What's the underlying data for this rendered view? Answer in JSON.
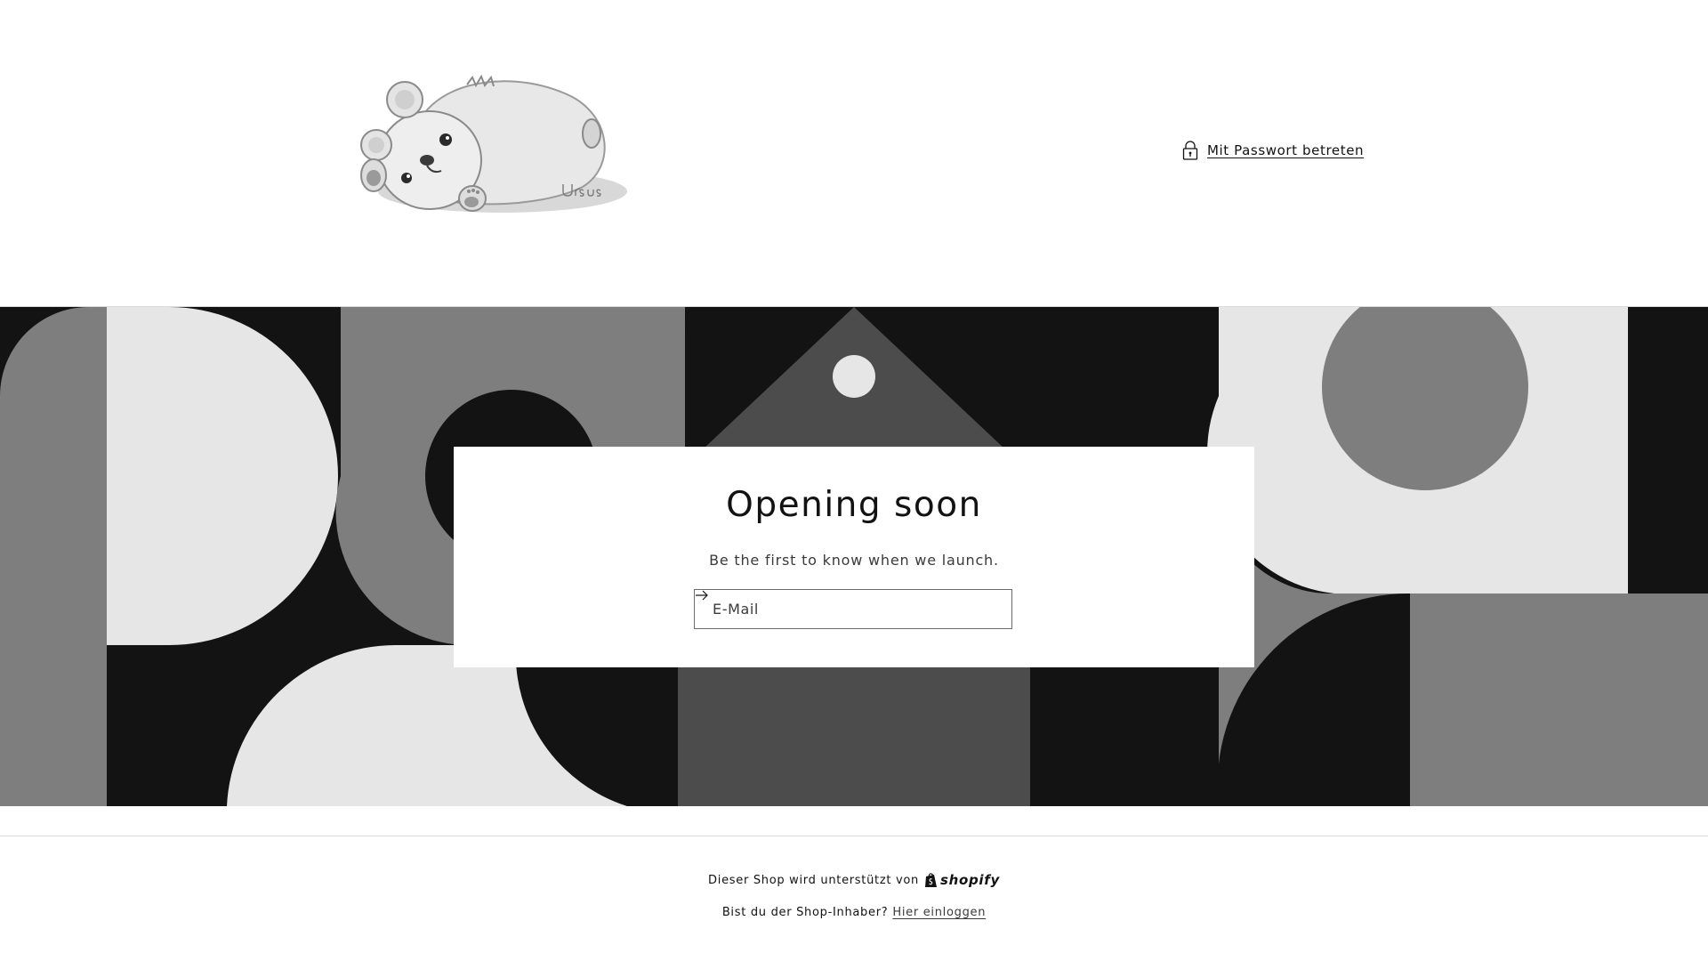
{
  "header": {
    "logo_alt": "Ursus",
    "logo_signature": "Ursus",
    "password_link": "Mit Passwort betreten"
  },
  "main": {
    "title": "Opening soon",
    "subtitle": "Be the first to know when we launch.",
    "email_placeholder": "E-Mail"
  },
  "footer": {
    "powered_by": "Dieser Shop wird unterstützt von",
    "shopify_wordmark": "shopify",
    "owner_question": "Bist du der Shop-Inhaber?",
    "login_link": "Hier einloggen"
  },
  "colors": {
    "black": "#131313",
    "dark_gray": "#4c4c4c",
    "mid_gray": "#7e7e7e",
    "light_gray": "#e6e6e6",
    "white": "#ffffff"
  }
}
